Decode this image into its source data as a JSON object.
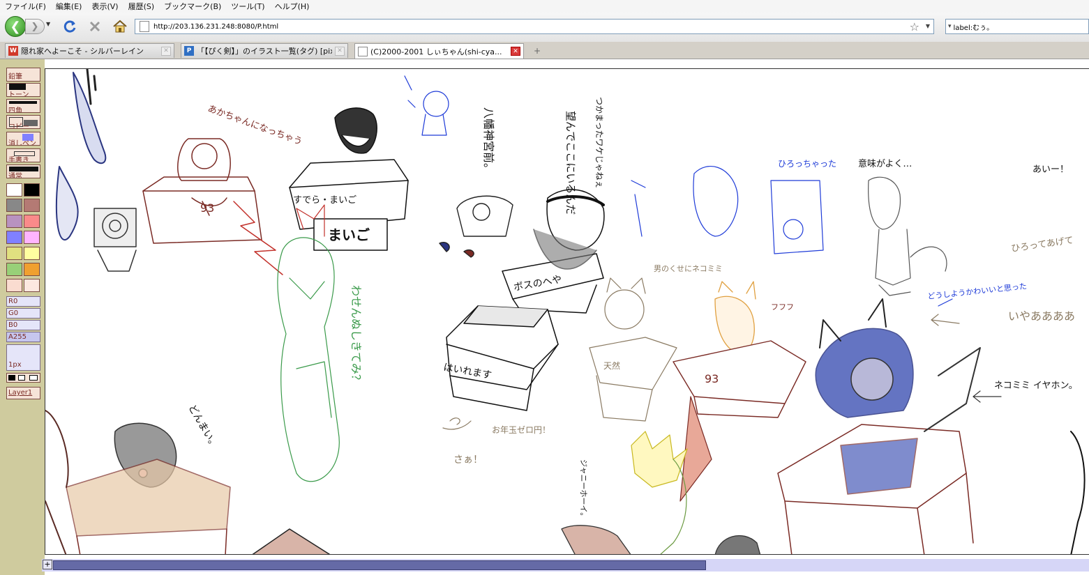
{
  "menu": [
    "ファイル(F)",
    "編集(E)",
    "表示(V)",
    "履歴(S)",
    "ブックマーク(B)",
    "ツール(T)",
    "ヘルプ(H)"
  ],
  "nav": {
    "url": "http://203.136.231.248:8080/P.html",
    "search_value": "label:むぅ。"
  },
  "tabs": [
    {
      "label": "隠れ家へよーこそ - シルバーレイン",
      "fav_color": "#d13a2b",
      "fav_letter": "W"
    },
    {
      "label": "「【ぴく剣】」のイラスト一覧(タグ) [pixiv]",
      "fav_color": "#2f6fc4",
      "fav_letter": "P"
    },
    {
      "label": "(C)2000-2001 しぃちゃん(shi-cya...",
      "fav_color": "#ffffff",
      "fav_letter": ""
    }
  ],
  "tools": {
    "pencil": "鉛筆",
    "tone": "トーン",
    "rect": "四角",
    "copy": "コピー",
    "eraser": "消しペン",
    "hand": "手書き",
    "normal": "通常",
    "layer": "Layer1"
  },
  "palette": [
    "#ffffff",
    "#000000",
    "#888888",
    "#b47a74",
    "#b892c0",
    "#fa8a8a",
    "#8080ff",
    "#ffb4ff",
    "#e0e080",
    "#fffea0",
    "#98d078",
    "#f0a030",
    "#fadcd0",
    "#fde8e0"
  ],
  "sliders": {
    "r": "R0",
    "g": "G0",
    "b": "B0",
    "a": "A255",
    "a_level": 1.0,
    "size": "1px"
  },
  "canvas_text": {
    "t1": "あかちゃんになっちゃう",
    "t2": "すでら・まいご",
    "t3": "まいご",
    "t4": "八幡神宮前。",
    "t5": "望んでここにいるんだ",
    "t6": "つかまったワケじゃねぇ",
    "t7": "ボスのへや",
    "t8": "はいれます",
    "t9": "いやああああ",
    "t10": "意味がよく…",
    "t11": "ひろってあげて",
    "t12": "ひろっちゃった",
    "t13": "あいー！",
    "t14": "どうしようかわいいと思った",
    "t15": "ネコミミ イヤホン。",
    "t16": "男のくせにネコミミ",
    "t17": "どんまい。",
    "t18": "わせんぬしきてみ？",
    "t19": "ジャニーホーイ。",
    "t20": "さぁ！",
    "t21": "お年玉ゼロ円！",
    "t22": "93",
    "t23": "天然",
    "t24": "フフフ"
  },
  "scroll": {
    "position": 0.63
  }
}
